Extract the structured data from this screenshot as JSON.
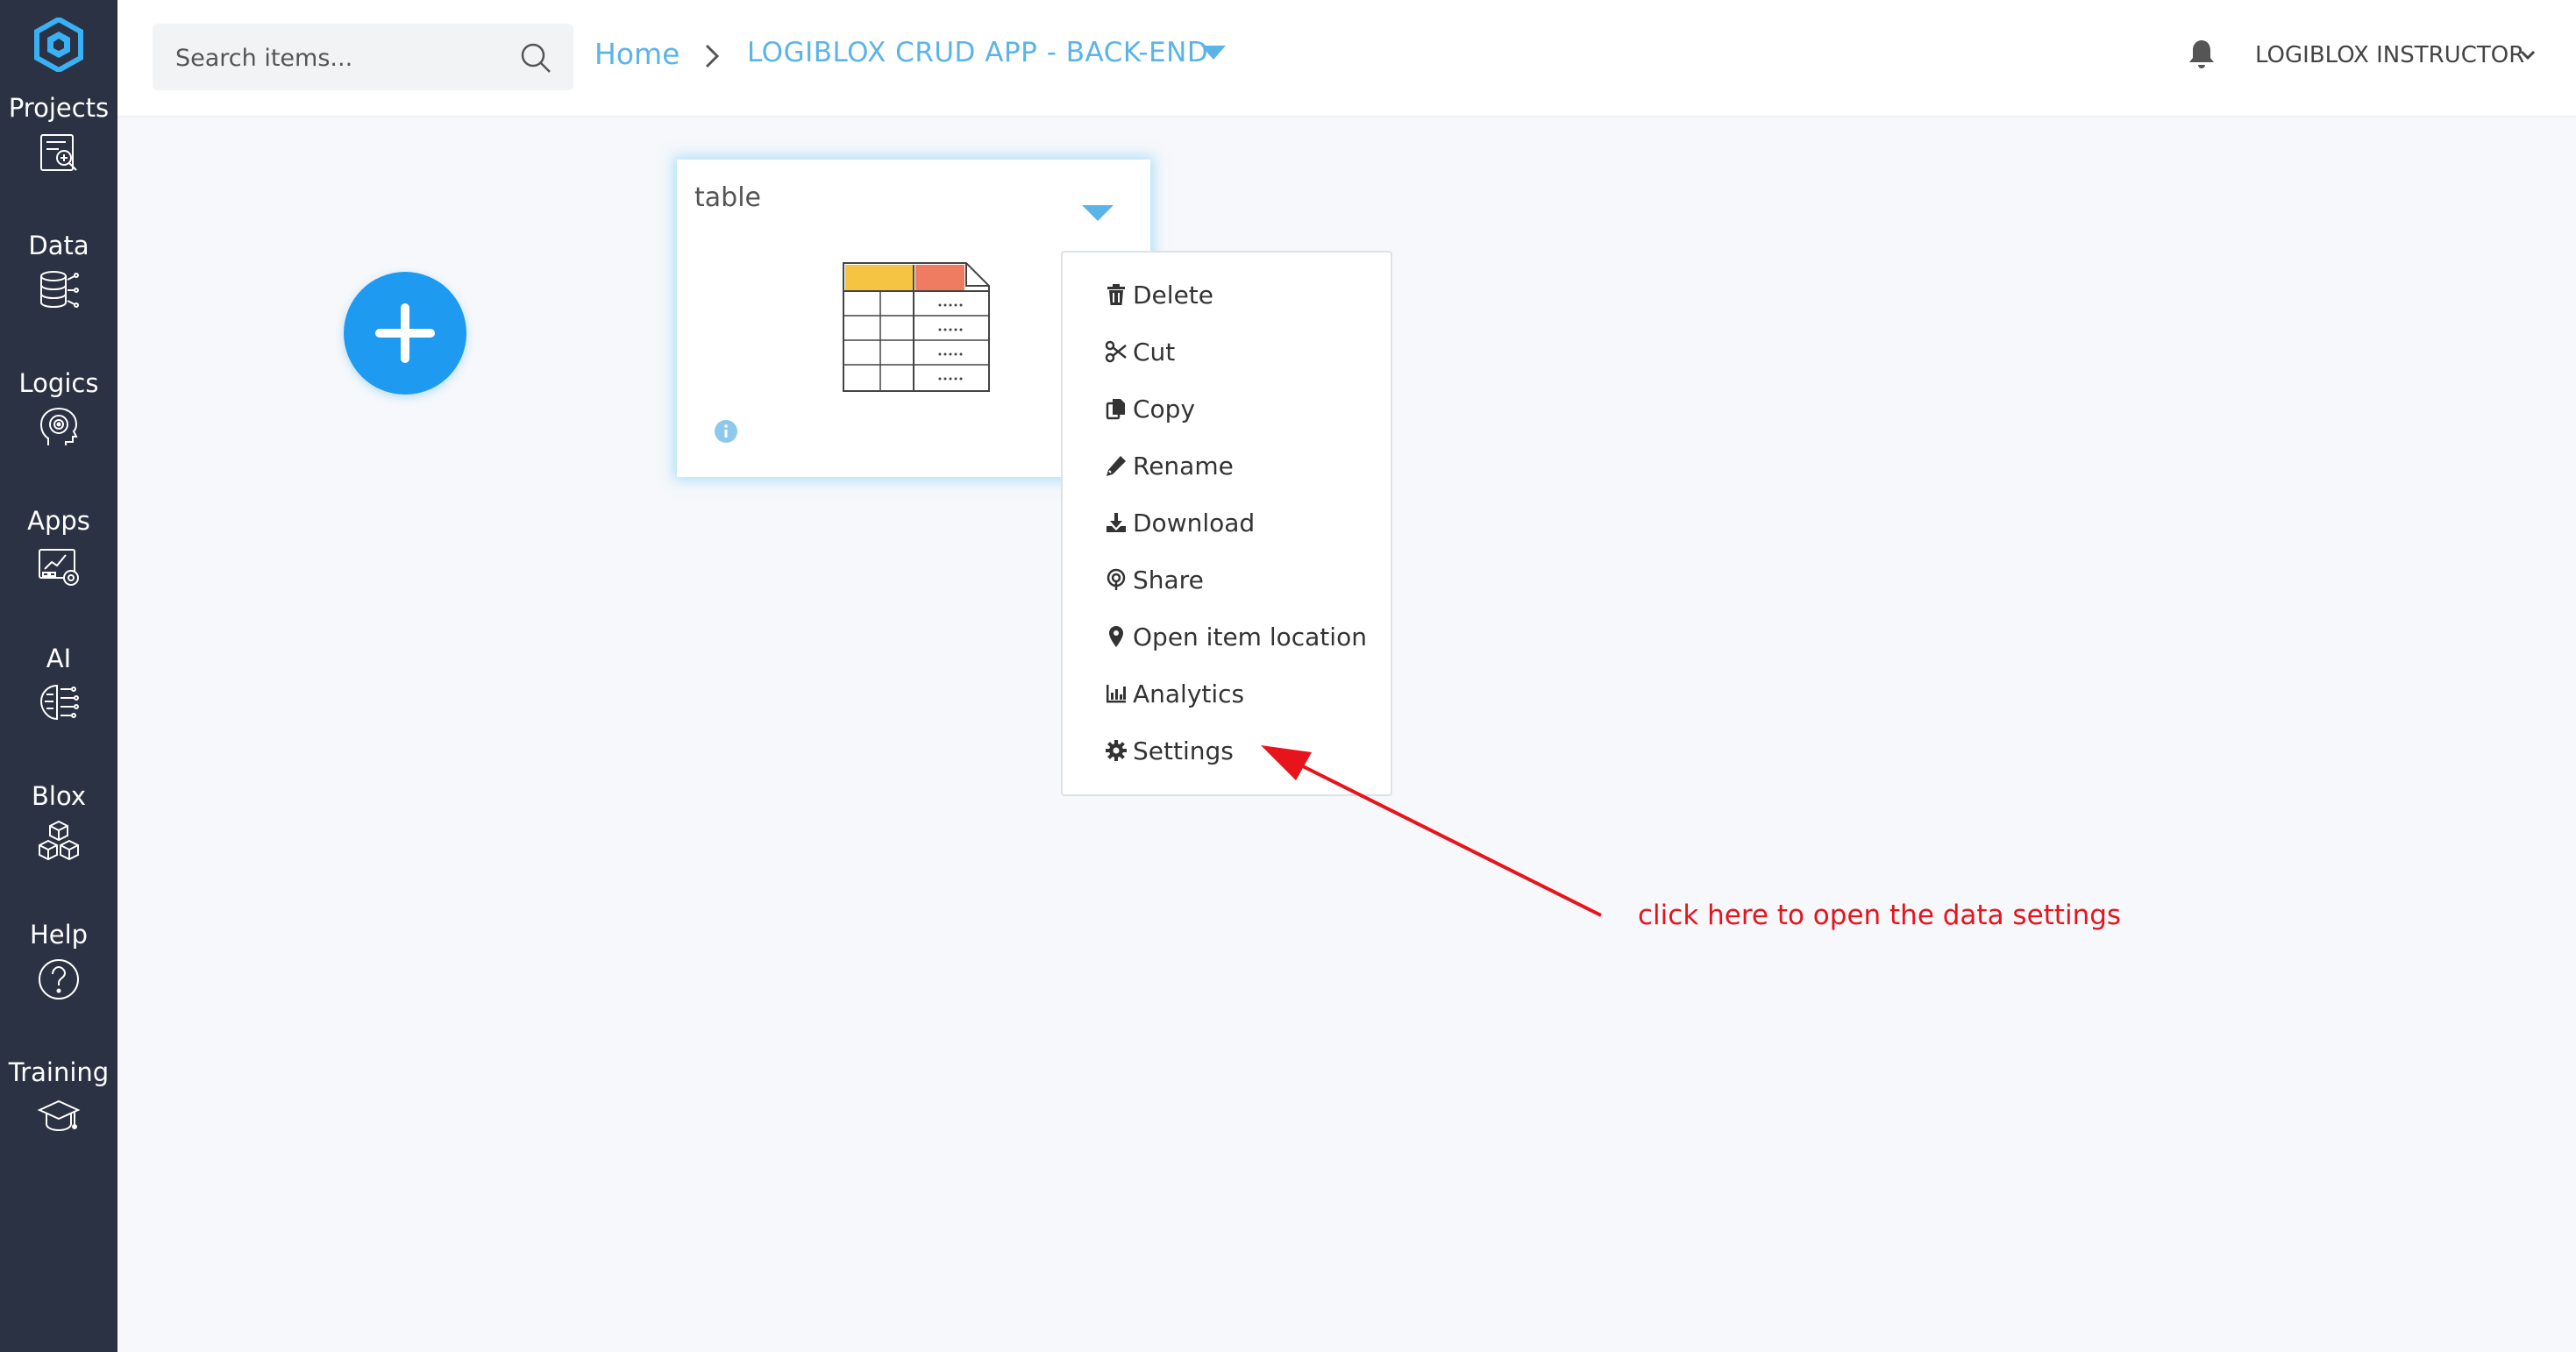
{
  "sidebar": {
    "items": [
      {
        "label": "Projects",
        "icon": "projects-icon"
      },
      {
        "label": "Data",
        "icon": "database-icon"
      },
      {
        "label": "Logics",
        "icon": "brain-head-icon"
      },
      {
        "label": "Apps",
        "icon": "apps-dashboard-icon"
      },
      {
        "label": "AI",
        "icon": "ai-chip-icon"
      },
      {
        "label": "Blox",
        "icon": "cubes-icon"
      },
      {
        "label": "Help",
        "icon": "question-icon"
      },
      {
        "label": "Training",
        "icon": "graduation-cap-icon"
      }
    ]
  },
  "header": {
    "search_placeholder": "Search items...",
    "breadcrumb_home": "Home",
    "breadcrumb_project": "LOGIBLOX CRUD APP - BACK-END",
    "user_name": "LOGIBLOX INSTRUCTOR"
  },
  "card": {
    "title": "table"
  },
  "context_menu": {
    "items": [
      {
        "label": "Delete",
        "icon": "trash-icon"
      },
      {
        "label": "Cut",
        "icon": "scissors-icon"
      },
      {
        "label": "Copy",
        "icon": "copy-icon"
      },
      {
        "label": "Rename",
        "icon": "pencil-icon"
      },
      {
        "label": "Download",
        "icon": "download-icon"
      },
      {
        "label": "Share",
        "icon": "share-icon"
      },
      {
        "label": "Open item location",
        "icon": "map-pin-icon"
      },
      {
        "label": "Analytics",
        "icon": "chart-icon"
      },
      {
        "label": "Settings",
        "icon": "gear-icon"
      }
    ]
  },
  "annotation": {
    "text": "click here to open the data settings"
  },
  "colors": {
    "sidebar_bg": "#2b3243",
    "accent": "#1e9af0",
    "breadcrumb": "#5bb4e8",
    "annotation": "#e8141c"
  }
}
